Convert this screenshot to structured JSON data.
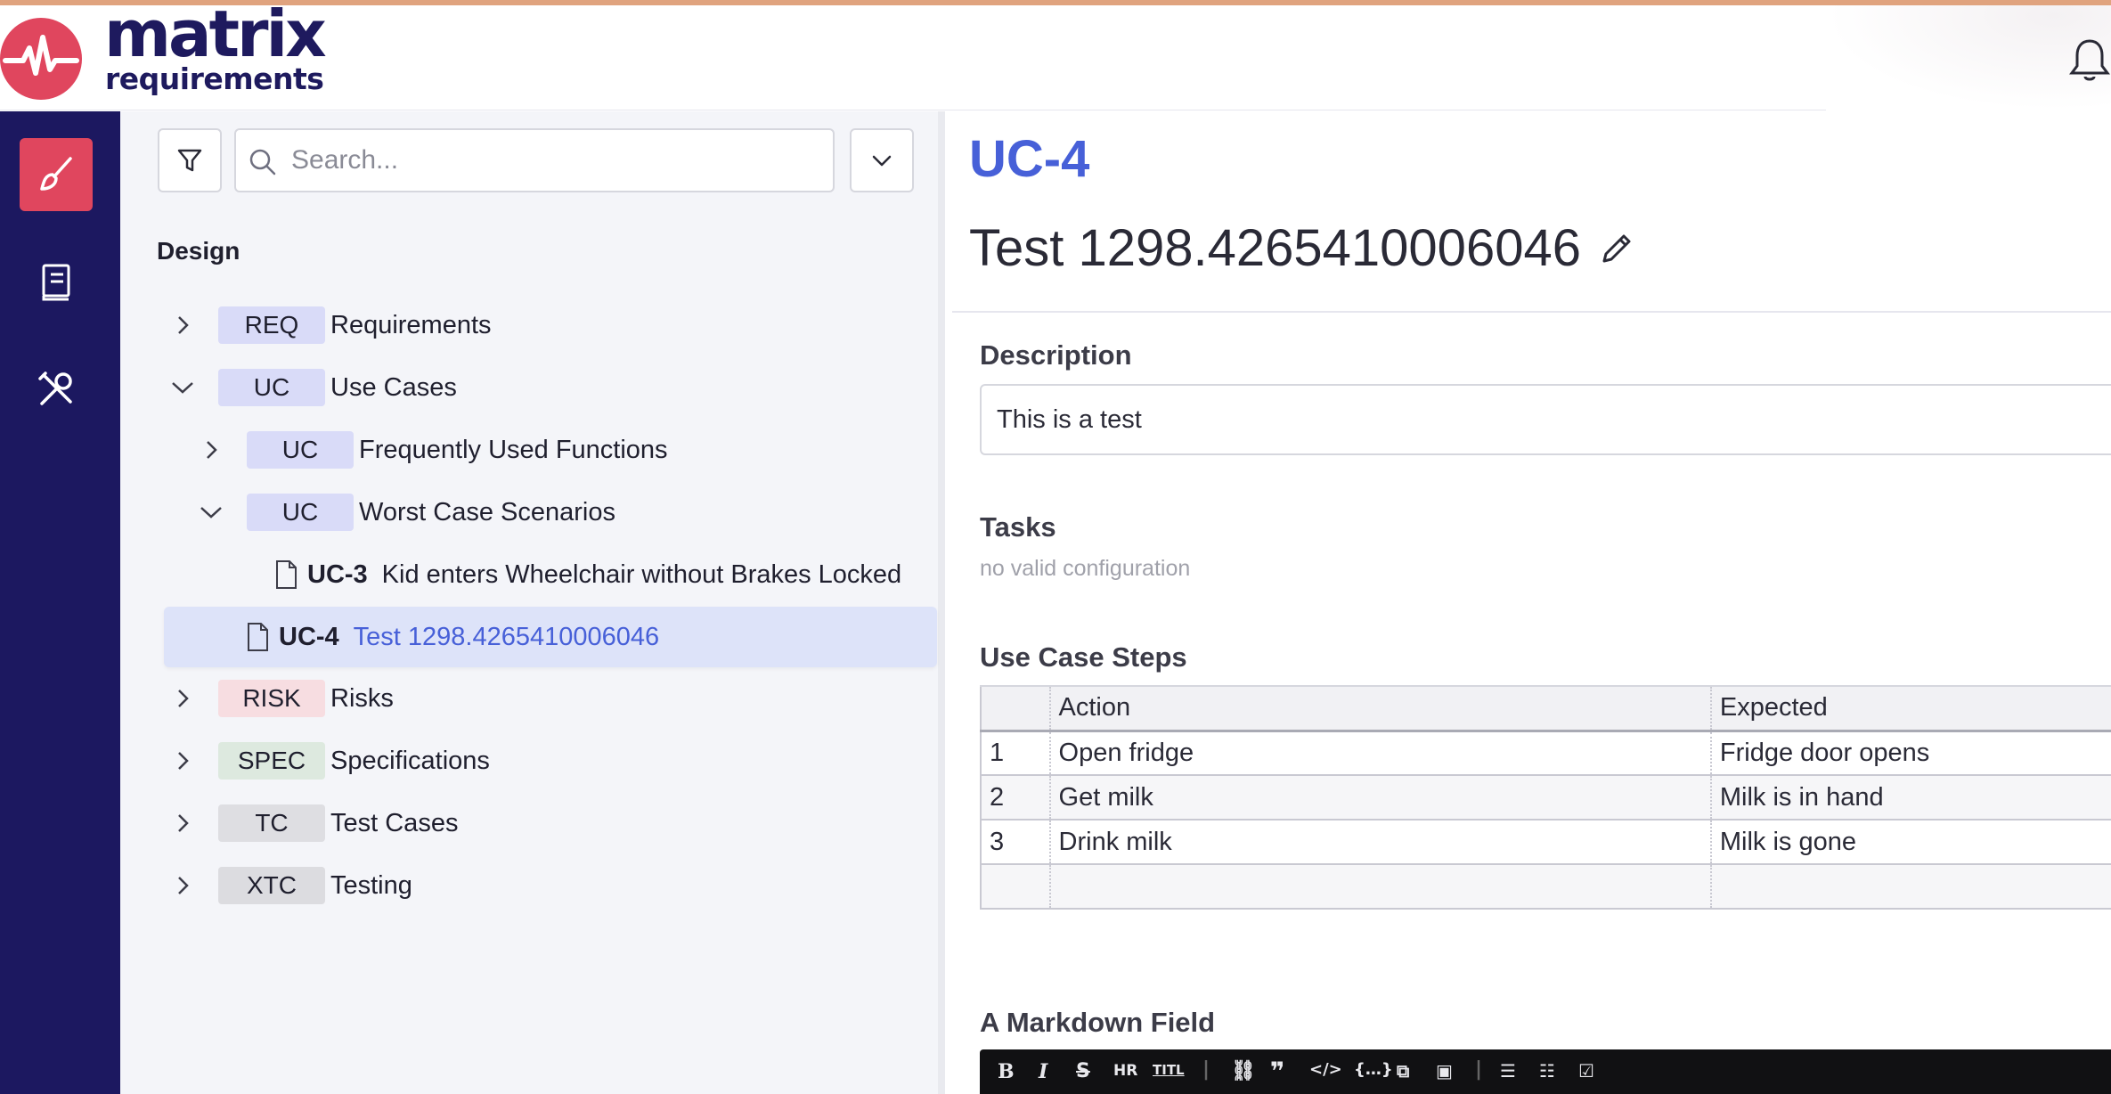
{
  "app": {
    "logo_line1": "matrix",
    "logo_line2": "requirements",
    "brand_color": "#e0465e",
    "nav_color": "#1c1860",
    "accent_color": "#4760d8"
  },
  "nav": {
    "items": [
      {
        "icon": "paintbrush-icon",
        "active": true
      },
      {
        "icon": "book-icon",
        "active": false
      },
      {
        "icon": "tools-icon",
        "active": false
      }
    ]
  },
  "tree": {
    "search_placeholder": "Search...",
    "title": "Design",
    "rows": [
      {
        "badge": "REQ",
        "label": "Requirements"
      },
      {
        "badge": "UC",
        "label": "Use Cases"
      },
      {
        "badge": "UC",
        "label": "Frequently Used Functions"
      },
      {
        "badge": "UC",
        "label": "Worst Case Scenarios"
      },
      {
        "id": "UC-3",
        "label": "Kid enters Wheelchair without Brakes Locked"
      },
      {
        "id": "UC-4",
        "label": "Test 1298.4265410006046"
      },
      {
        "badge": "RISK",
        "label": "Risks"
      },
      {
        "badge": "SPEC",
        "label": "Specifications"
      },
      {
        "badge": "TC",
        "label": "Test Cases"
      },
      {
        "badge": "XTC",
        "label": "Testing"
      }
    ]
  },
  "detail": {
    "ref": "UC-4",
    "title": "Test 1298.4265410006046",
    "description_label": "Description",
    "description_value": "This is a test",
    "tasks_label": "Tasks",
    "tasks_value": "no valid configuration",
    "steps_label": "Use Case Steps",
    "steps_columns": [
      "",
      "Action",
      "Expected"
    ],
    "steps_rows": [
      [
        "1",
        "Open fridge",
        "Fridge door opens"
      ],
      [
        "2",
        "Get milk",
        "Milk is in hand"
      ],
      [
        "3",
        "Drink milk",
        "Milk is gone"
      ],
      [
        "",
        "",
        ""
      ]
    ],
    "markdown_label": "A Markdown Field",
    "markdown_toolbar": [
      "B",
      "I",
      "S",
      "HR",
      "TITL",
      "link",
      "quote",
      "code",
      "codeblock",
      "embed",
      "image",
      "ul",
      "ol",
      "checklist"
    ]
  }
}
